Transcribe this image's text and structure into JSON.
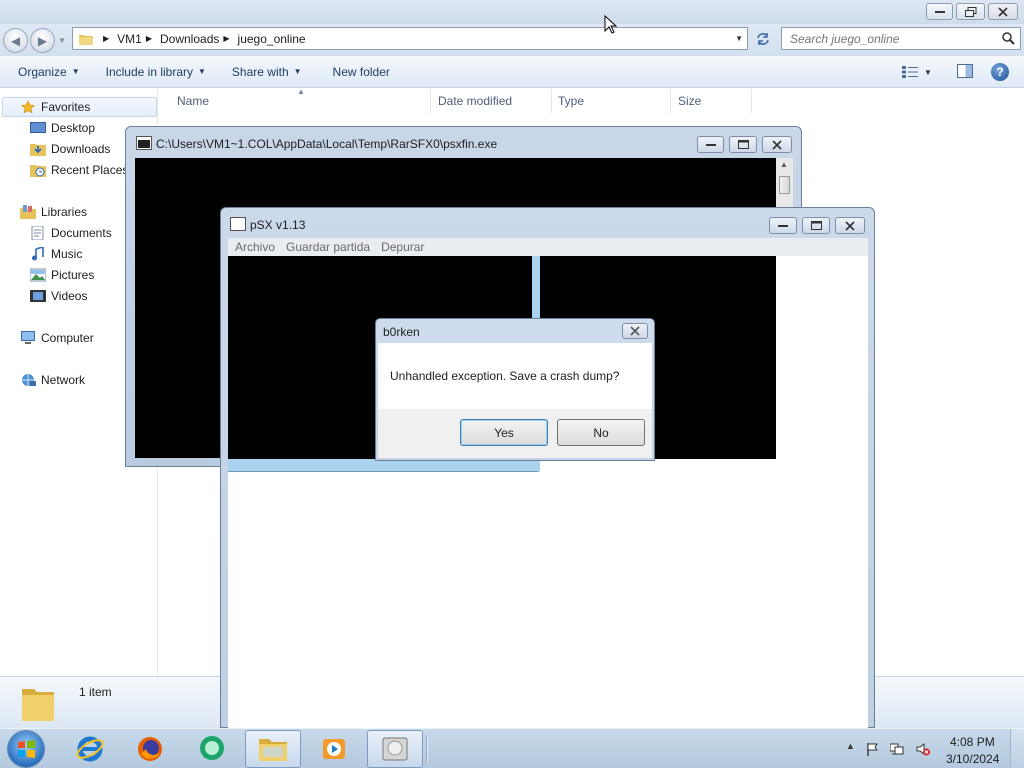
{
  "explorer": {
    "breadcrumbs": [
      "VM1",
      "Downloads",
      "juego_online"
    ],
    "search_placeholder": "Search juego_online",
    "toolbar": {
      "organize": "Organize",
      "include_in_library": "Include in library",
      "share_with": "Share with",
      "new_folder": "New folder"
    },
    "nav": {
      "favorites": "Favorites",
      "desktop": "Desktop",
      "downloads": "Downloads",
      "recent_places": "Recent Places",
      "libraries": "Libraries",
      "documents": "Documents",
      "music": "Music",
      "pictures": "Pictures",
      "videos": "Videos",
      "computer": "Computer",
      "network": "Network"
    },
    "columns": [
      "Name",
      "Date modified",
      "Type",
      "Size"
    ],
    "item_count": "1 item"
  },
  "console_window": {
    "title": "C:\\Users\\VM1~1.COL\\AppData\\Local\\Temp\\RarSFX0\\psxfin.exe"
  },
  "psx_window": {
    "title": "pSX v1.13",
    "menu": [
      "Archivo",
      "Guardar partida",
      "Depurar"
    ]
  },
  "dialog": {
    "title": "b0rken",
    "message": "Unhandled exception.  Save a crash dump?",
    "yes": "Yes",
    "no": "No"
  },
  "taskbar": {
    "apps": [
      "internet-explorer",
      "firefox",
      "app-green",
      "windows-explorer",
      "media-player",
      "psx-emulator"
    ],
    "time": "4:08 PM",
    "date": "3/10/2024"
  },
  "colors": {
    "explorer_chrome": "#dfe9f5",
    "window_frame": "#c9d7e8",
    "console_bg": "#000000",
    "psx_divider": "#a9d3ef",
    "taskbar": "#c8d9ea"
  }
}
